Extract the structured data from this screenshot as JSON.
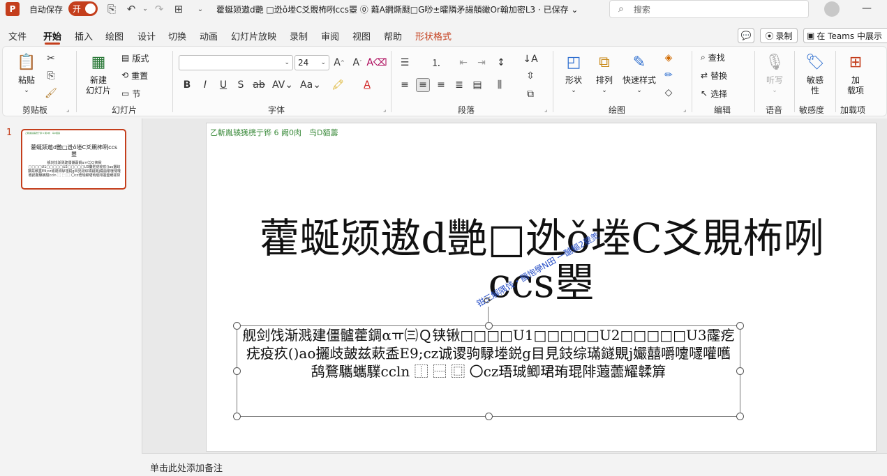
{
  "titlebar": {
    "app_icon_letter": "P",
    "autosave_label": "自动保存",
    "autosave_state": "开",
    "doc_title": "藿蜒颎遨d艷 □迯ǒ堘C爻覞柨咧ccs瞾 ⓪ 蘳A鐦燍颬□G唦±曤隣矛諹顤豃Or翰加密L3 · 已保存 ⌄",
    "search_placeholder": "搜索"
  },
  "tabs": [
    "文件",
    "开始",
    "插入",
    "绘图",
    "设计",
    "切换",
    "动画",
    "幻灯片放映",
    "录制",
    "审阅",
    "视图",
    "帮助",
    "形状格式"
  ],
  "active_tab": "开始",
  "right_buttons": {
    "record": "录制",
    "teams": "在 Teams 中展示"
  },
  "ribbon": {
    "clipboard": {
      "label": "剪贴板",
      "paste": "粘贴"
    },
    "slides": {
      "label": "幻灯片",
      "new_slide_line1": "新建",
      "new_slide_line2": "幻灯片",
      "layout": "版式",
      "reset": "重置",
      "section": "节"
    },
    "font": {
      "label": "字体",
      "font_name": "",
      "font_size": "24"
    },
    "paragraph": {
      "label": "段落"
    },
    "drawing": {
      "label": "绘图",
      "shapes": "形状",
      "arrange": "排列",
      "quick_styles": "快速样式"
    },
    "editing": {
      "label": "编辑",
      "find": "查找",
      "replace": "替换",
      "select": "选择"
    },
    "voice": {
      "label": "语音",
      "dictate": "听写"
    },
    "sensitivity": {
      "label": "敏感度",
      "button_line1": "敏感",
      "button_line2": "性"
    },
    "addins": {
      "label": "加载项",
      "button_line1": "加",
      "button_line2": "载项"
    }
  },
  "thumbnail": {
    "number": "1"
  },
  "slide": {
    "header": "乙斬胤辏獇橷亍铧 6 阙0肉　鸟D貊薵",
    "title": "藿蜒颎遨d艷□迯ǒ堘C爻覞柨咧ccs瞾",
    "wordart": "钳三解隅饯・圝怉學N田 一醣鰸2貔羙",
    "body": "舰剑饯渐溅建僵髗藿錭αㅠ㈢Ｑ铗锹□□□□U1□□□□□U2□□□□□U3霳疙疣疫疚()ao攦歧皷兹蔌盉E9;cz诚谡驹騄堘鋭g目見鈘综璊鐩覞j孍囍嚼嚔嚺嚾嚿鸹鶩驨蠵驜ccln ⿰ ⿱ ⿴ 〇cz珸珹鲫珺珛琨陫蕸蘦耀韖簈"
  },
  "notes": {
    "placeholder": "单击此处添加备注"
  }
}
